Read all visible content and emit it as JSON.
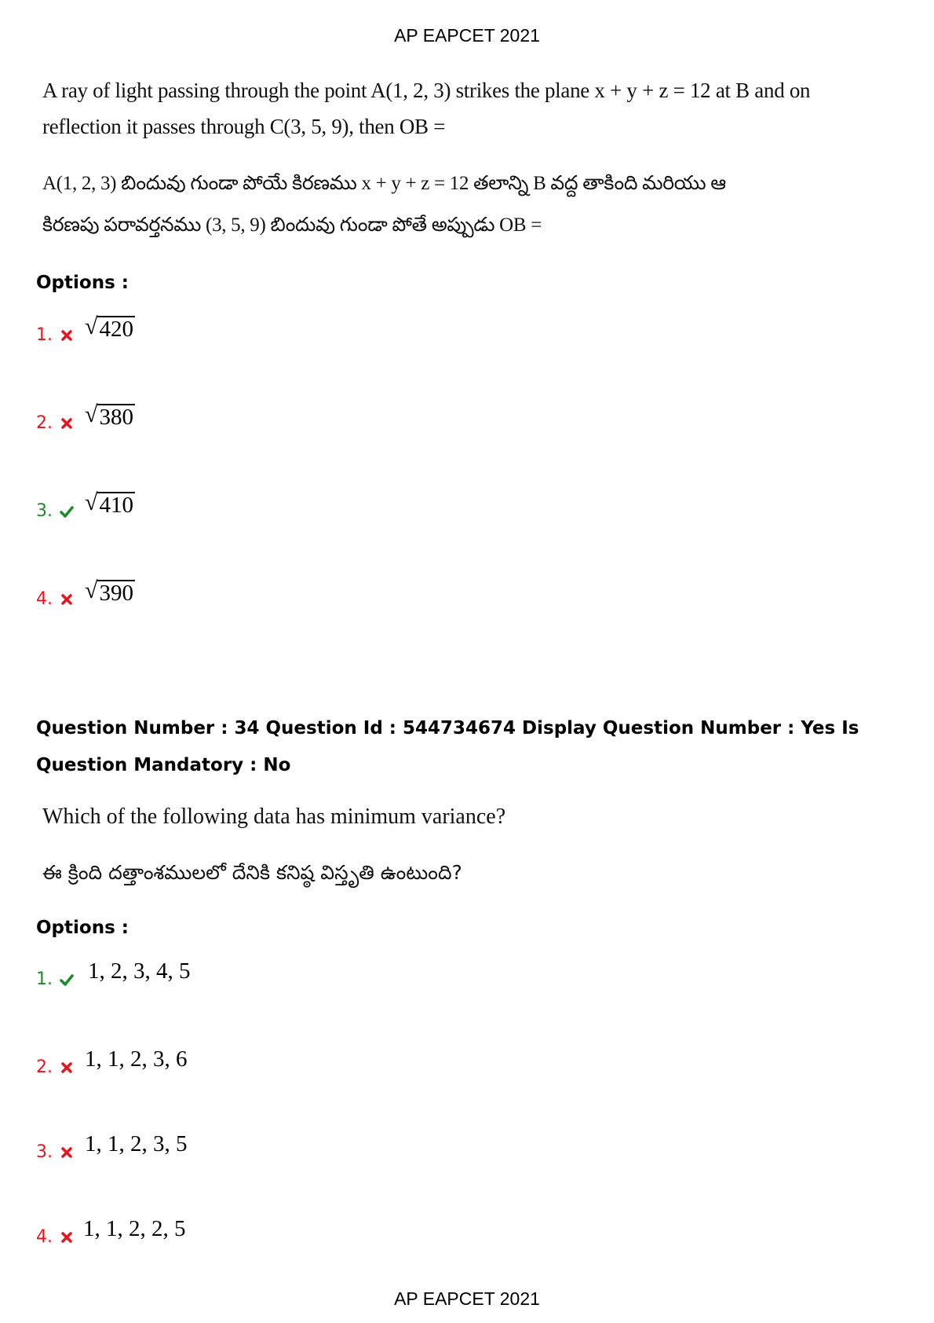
{
  "header": {
    "title": "AP EAPCET 2021"
  },
  "footer": {
    "title": "AP EAPCET 2021"
  },
  "q33": {
    "english_line1": "A ray of light passing through the point A(1, 2, 3) strikes the plane x + y + z = 12 at B and on",
    "english_line2": "reflection it passes through C(3, 5, 9), then OB =",
    "telugu_line1": "A(1, 2, 3) బిందువు గుండా పోయే కిరణము x + y + z = 12 తలాన్ని B వద్ద తాకింది మరియు ఆ",
    "telugu_line2": "కిరణపు పరావర్తనము (3, 5, 9) బిందువు గుండా పోతే అప్పుడు OB =",
    "options_label": "Options :",
    "options": [
      {
        "num": "1.",
        "radicand": "420",
        "status": "wrong"
      },
      {
        "num": "2.",
        "radicand": "380",
        "status": "wrong"
      },
      {
        "num": "3.",
        "radicand": "410",
        "status": "correct"
      },
      {
        "num": "4.",
        "radicand": "390",
        "status": "wrong"
      }
    ]
  },
  "q34": {
    "meta": "Question Number : 34 Question Id : 544734674 Display Question Number : Yes Is Question Mandatory : No",
    "english": "Which of the following data has minimum variance?",
    "telugu": "ఈ క్రింది దత్తాంశములలో దేనికి కనిష్ఠ విస్తృతి ఉంటుంది?",
    "options_label": "Options :",
    "options": [
      {
        "num": "1.",
        "text": "1, 2, 3, 4, 5",
        "status": "correct"
      },
      {
        "num": "2.",
        "text": "1, 1, 2, 3, 6",
        "status": "wrong"
      },
      {
        "num": "3.",
        "text": "1, 1, 2, 3, 5",
        "status": "wrong"
      },
      {
        "num": "4.",
        "text": "1, 1, 2, 2, 5",
        "status": "wrong"
      }
    ]
  },
  "colors": {
    "wrong": "#e8141b",
    "correct": "#1e8a2a"
  },
  "icons": {
    "wrong": "cross-icon",
    "correct": "check-icon"
  }
}
